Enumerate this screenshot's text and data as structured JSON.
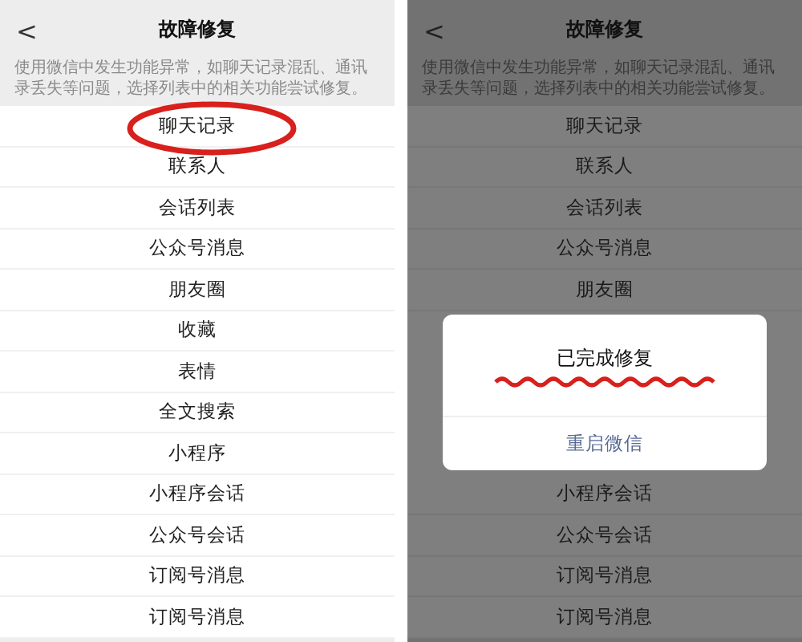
{
  "screens": [
    {
      "dimmed": false,
      "back": "<",
      "title": "故障修复",
      "description": "使用微信中发生功能异常，如聊天记录混乱、通讯录丢失等问题，选择列表中的相关功能尝试修复。",
      "rows_above": [
        {
          "label": "聊天记录",
          "circled": true
        },
        {
          "label": "联系人",
          "circled": false
        },
        {
          "label": "会话列表",
          "circled": false
        },
        {
          "label": "公众号消息",
          "circled": false
        },
        {
          "label": "朋友圈",
          "circled": false
        },
        {
          "label": "收藏",
          "circled": false
        },
        {
          "label": "表情",
          "circled": false
        },
        {
          "label": "全文搜索",
          "circled": false
        },
        {
          "label": "小程序",
          "circled": false
        },
        {
          "label": "小程序会话",
          "circled": false
        },
        {
          "label": "公众号会话",
          "circled": false
        },
        {
          "label": "订阅号消息",
          "circled": false
        },
        {
          "label": "订阅号消息",
          "circled": false
        }
      ]
    },
    {
      "dimmed": true,
      "back": "<",
      "title": "故障修复",
      "description": "使用微信中发生功能异常，如聊天记录混乱、通讯录丢失等问题，选择列表中的相关功能尝试修复。",
      "rows_above": [
        {
          "label": "聊天记录",
          "circled": false
        },
        {
          "label": "联系人",
          "circled": false
        },
        {
          "label": "会话列表",
          "circled": false
        },
        {
          "label": "公众号消息",
          "circled": false
        },
        {
          "label": "朋友圈",
          "circled": false
        }
      ],
      "dialog": {
        "message": "已完成修复",
        "underlined": true,
        "button": "重启微信"
      },
      "rows_below": [
        {
          "label": "小程序会话",
          "circled": false
        },
        {
          "label": "公众号会话",
          "circled": false
        },
        {
          "label": "订阅号消息",
          "circled": false
        },
        {
          "label": "订阅号消息",
          "circled": false
        }
      ]
    }
  ]
}
